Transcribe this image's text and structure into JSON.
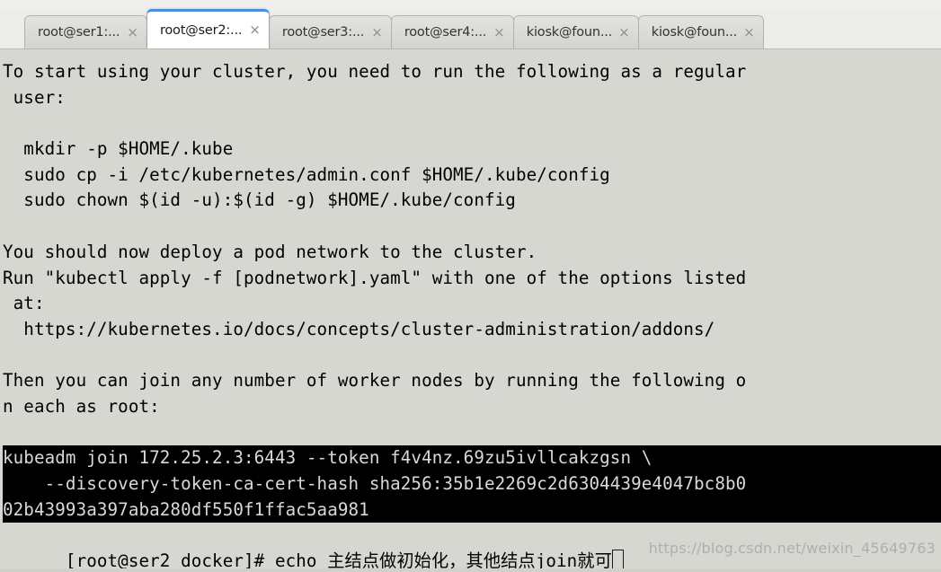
{
  "window": {
    "tabs": [
      {
        "label": "root@ser1:...",
        "close_icon": "×",
        "active": false
      },
      {
        "label": "root@ser2:...",
        "close_icon": "×",
        "active": true
      },
      {
        "label": "root@ser3:...",
        "close_icon": "×",
        "active": false
      },
      {
        "label": "root@ser4:...",
        "close_icon": "×",
        "active": false
      },
      {
        "label": "kiosk@foun...",
        "close_icon": "×",
        "active": false
      },
      {
        "label": "kiosk@foun...",
        "close_icon": "×",
        "active": false
      }
    ]
  },
  "terminal": {
    "lines": [
      "To start using your cluster, you need to run the following as a regular",
      " user:",
      "",
      "  mkdir -p $HOME/.kube",
      "  sudo cp -i /etc/kubernetes/admin.conf $HOME/.kube/config",
      "  sudo chown $(id -u):$(id -g) $HOME/.kube/config",
      "",
      "You should now deploy a pod network to the cluster.",
      "Run \"kubectl apply -f [podnetwork].yaml\" with one of the options listed",
      " at:",
      "  https://kubernetes.io/docs/concepts/cluster-administration/addons/",
      "",
      "Then you can join any number of worker nodes by running the following o",
      "n each as root:",
      ""
    ],
    "highlighted_lines": [
      "kubeadm join 172.25.2.3:6443 --token f4v4nz.69zu5ivllcakzgsn \\",
      "    --discovery-token-ca-cert-hash sha256:35b1e2269c2d6304439e4047bc8b0",
      "02b43993a397aba280df550f1ffac5aa981"
    ],
    "prompt": {
      "user_host": "[root@ser2 docker]# ",
      "command": "echo ",
      "cjk_text": "主结点做初始化，其他结点",
      "command_tail": "join",
      "cjk_tail": "就可"
    }
  },
  "watermark": {
    "text": "https://blog.csdn.net/weixin_45649763"
  },
  "colors": {
    "terminal_bg": "#d5d7d0",
    "terminal_fg": "#000000",
    "highlight_bg": "#000000",
    "highlight_fg": "#d9d9d9",
    "active_tab_accent": "#4a90d9",
    "tabbar_bg": "#ececeb"
  }
}
